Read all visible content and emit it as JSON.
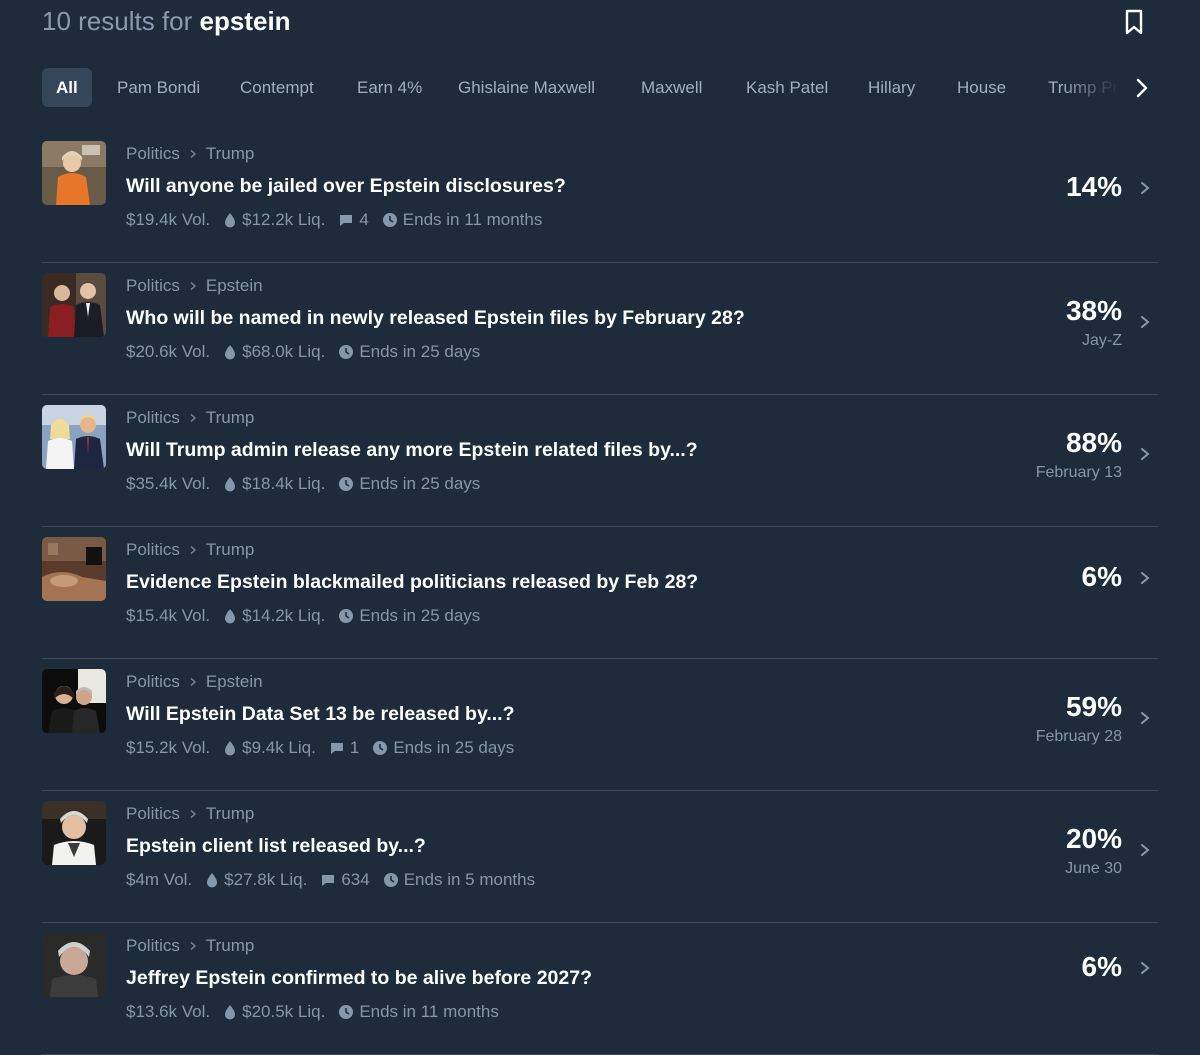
{
  "header": {
    "results_prefix": "10 results for",
    "query": "epstein",
    "bookmark_icon": "bookmark-icon"
  },
  "filters": {
    "chips": [
      "All",
      "Pam Bondi",
      "Contempt",
      "Earn 4%",
      "Ghislaine Maxwell",
      "Maxwell",
      "Kash Patel",
      "Hillary",
      "House",
      "Trump Pr"
    ],
    "active": "All",
    "next_icon": "chevron-right-icon"
  },
  "markets": [
    {
      "category": "Politics",
      "subcategory": "Trump",
      "title": "Will anyone be jailed over Epstein disclosures?",
      "volume": "$19.4k Vol.",
      "liquidity": "$12.2k Liq.",
      "comments": "4",
      "ends": "Ends in 11 months",
      "percent": "14%",
      "outcome": ""
    },
    {
      "category": "Politics",
      "subcategory": "Epstein",
      "title": "Who will be named in newly released Epstein files by February 28?",
      "volume": "$20.6k Vol.",
      "liquidity": "$68.0k Liq.",
      "comments": "",
      "ends": "Ends in 25 days",
      "percent": "38%",
      "outcome": "Jay-Z"
    },
    {
      "category": "Politics",
      "subcategory": "Trump",
      "title": "Will Trump admin release any more Epstein related files by...?",
      "volume": "$35.4k Vol.",
      "liquidity": "$18.4k Liq.",
      "comments": "",
      "ends": "Ends in 25 days",
      "percent": "88%",
      "outcome": "February 13"
    },
    {
      "category": "Politics",
      "subcategory": "Trump",
      "title": "Evidence Epstein blackmailed politicians released by Feb 28?",
      "volume": "$15.4k Vol.",
      "liquidity": "$14.2k Liq.",
      "comments": "",
      "ends": "Ends in 25 days",
      "percent": "6%",
      "outcome": ""
    },
    {
      "category": "Politics",
      "subcategory": "Epstein",
      "title": "Will Epstein Data Set 13 be released by...?",
      "volume": "$15.2k Vol.",
      "liquidity": "$9.4k Liq.",
      "comments": "1",
      "ends": "Ends in 25 days",
      "percent": "59%",
      "outcome": "February 28"
    },
    {
      "category": "Politics",
      "subcategory": "Trump",
      "title": "Epstein client list released by...?",
      "volume": "$4m Vol.",
      "liquidity": "$27.8k Liq.",
      "comments": "634",
      "ends": "Ends in 5 months",
      "percent": "20%",
      "outcome": "June 30"
    },
    {
      "category": "Politics",
      "subcategory": "Trump",
      "title": "Jeffrey Epstein confirmed to be alive before 2027?",
      "volume": "$13.6k Vol.",
      "liquidity": "$20.5k Liq.",
      "comments": "",
      "ends": "Ends in 11 months",
      "percent": "6%",
      "outcome": ""
    }
  ],
  "icons": {
    "liquidity": "droplet-icon",
    "comments": "comment-icon",
    "ends": "clock-icon",
    "breadcrumb_separator": "chevron-right-icon",
    "row_chevron": "chevron-right-icon"
  },
  "colors": {
    "background": "#1d2b3a",
    "active_chip": "#344657",
    "muted_text": "#8597aa",
    "divider": "#3a4a5b"
  }
}
